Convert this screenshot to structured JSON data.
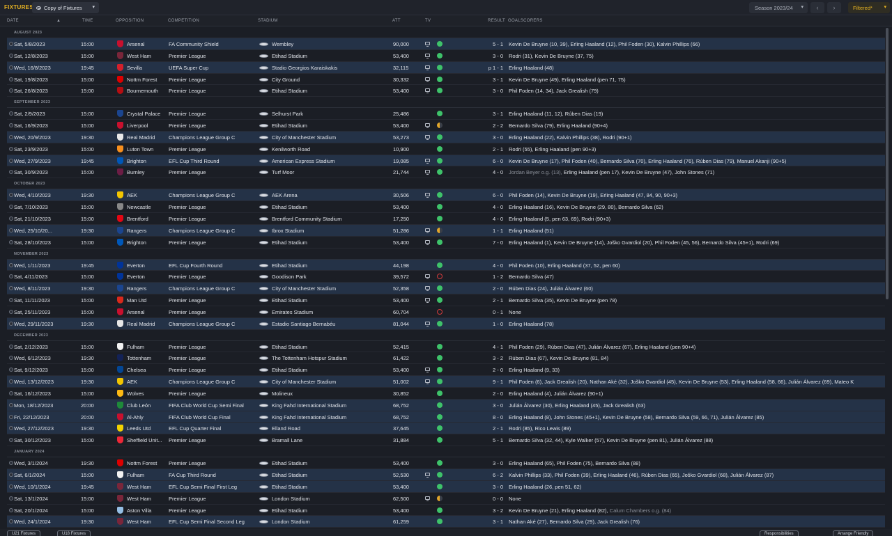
{
  "toolbar": {
    "title": "FIXTURES",
    "view": "Copy of Fixtures",
    "season": "Season 2023/24",
    "filter": "Filtered*"
  },
  "columns": {
    "date": "DATE",
    "time": "TIME",
    "opposition": "OPPOSITION",
    "competition": "COMPETITION",
    "stadium": "STADIUM",
    "att": "ATT",
    "tv": "TV",
    "result": "RESULT",
    "goalscorers": "GOALSCORERS"
  },
  "months": [
    {
      "label": "AUGUST 2023",
      "fixtures": [
        {
          "date": "Sat, 5/8/2023",
          "time": "15:00",
          "opp": "Arsenal",
          "comp": "FA Community Shield",
          "stadium": "Wembley",
          "att": "90,000",
          "tv": true,
          "outcome": "win",
          "result": "5 - 1",
          "scorers": "Kevin De Bruyne (10, 39), Erling Haaland (12), Phil Foden (30), Kalvin Phillips (66)",
          "badge": "#c8102e",
          "hl": true
        },
        {
          "date": "Sat, 12/8/2023",
          "time": "15:00",
          "opp": "West Ham",
          "comp": "Premier League",
          "stadium": "Etihad Stadium",
          "att": "53,400",
          "tv": true,
          "outcome": "win",
          "result": "3 - 0",
          "scorers": "Rodri (31), Kevin De Bruyne (37, 75)",
          "badge": "#7a263a",
          "hl": false
        },
        {
          "date": "Wed, 16/8/2023",
          "time": "19:45",
          "opp": "Sevilla",
          "comp": "UEFA Super Cup",
          "stadium": "Stadio Georgios Karaiskakis",
          "att": "32,115",
          "tv": true,
          "outcome": "win",
          "result": "p 1 - 1",
          "scorers": "Erling Haaland (48)",
          "badge": "#d4202b",
          "hl": true
        },
        {
          "date": "Sat, 19/8/2023",
          "time": "15:00",
          "opp": "Nottm Forest",
          "comp": "Premier League",
          "stadium": "City Ground",
          "att": "30,332",
          "tv": true,
          "outcome": "win",
          "result": "3 - 1",
          "scorers": "Kevin De Bruyne (49), Erling Haaland (pen 71, 75)",
          "badge": "#dd0000",
          "hl": false
        },
        {
          "date": "Sat, 26/8/2023",
          "time": "15:00",
          "opp": "Bournemouth",
          "comp": "Premier League",
          "stadium": "Etihad Stadium",
          "att": "53,400",
          "tv": true,
          "outcome": "win",
          "result": "3 - 0",
          "scorers": "Phil Foden (14, 34), Jack Grealish (79)",
          "badge": "#b50e12",
          "hl": false
        }
      ]
    },
    {
      "label": "SEPTEMBER 2023",
      "fixtures": [
        {
          "date": "Sat, 2/9/2023",
          "time": "15:00",
          "opp": "Crystal Palace",
          "comp": "Premier League",
          "stadium": "Selhurst Park",
          "att": "25,486",
          "tv": false,
          "outcome": "win",
          "result": "3 - 1",
          "scorers": "Erling Haaland (11, 12), Rúben Dias (19)",
          "badge": "#1b458f",
          "hl": false
        },
        {
          "date": "Sat, 16/9/2023",
          "time": "15:00",
          "opp": "Liverpool",
          "comp": "Premier League",
          "stadium": "Etihad Stadium",
          "att": "53,400",
          "tv": true,
          "outcome": "draw",
          "result": "2 - 2",
          "scorers": "Bernardo Silva (79), Erling Haaland (90+4)",
          "badge": "#c8102e",
          "hl": false
        },
        {
          "date": "Wed, 20/9/2023",
          "time": "19:30",
          "opp": "Real Madrid",
          "comp": "Champions League Group C",
          "stadium": "City of Manchester Stadium",
          "att": "53,273",
          "tv": true,
          "outcome": "win",
          "result": "3 - 0",
          "scorers": "Erling Haaland (22), Kalvin Phillips (38), Rodri (90+1)",
          "badge": "#e8e8e8",
          "hl": true
        },
        {
          "date": "Sat, 23/9/2023",
          "time": "15:00",
          "opp": "Luton Town",
          "comp": "Premier League",
          "stadium": "Kenilworth Road",
          "att": "10,900",
          "tv": false,
          "outcome": "win",
          "result": "2 - 1",
          "scorers": "Rodri (55), Erling Haaland (pen 90+3)",
          "badge": "#f78f1e",
          "hl": false
        },
        {
          "date": "Wed, 27/9/2023",
          "time": "19:45",
          "opp": "Brighton",
          "comp": "EFL Cup Third Round",
          "stadium": "American Express Stadium",
          "att": "19,085",
          "tv": true,
          "outcome": "win",
          "result": "6 - 0",
          "scorers": "Kevin De Bruyne (17), Phil Foden (40), Bernardo Silva (70), Erling Haaland (76), Rúben Dias (79), Manuel Akanji (90+5)",
          "badge": "#0057b8",
          "hl": true
        },
        {
          "date": "Sat, 30/9/2023",
          "time": "15:00",
          "opp": "Burnley",
          "comp": "Premier League",
          "stadium": "Turf Moor",
          "att": "21,744",
          "tv": true,
          "outcome": "win",
          "result": "4 - 0",
          "og": "Jordan Beyer o.g. (13),",
          "scorers": "Erling Haaland (pen 17), Kevin De Bruyne (47), John Stones (71)",
          "badge": "#6c1d45",
          "hl": false
        }
      ]
    },
    {
      "label": "OCTOBER 2023",
      "fixtures": [
        {
          "date": "Wed, 4/10/2023",
          "time": "19:30",
          "opp": "AEK",
          "comp": "Champions League Group C",
          "stadium": "AEK Arena",
          "att": "30,506",
          "tv": true,
          "outcome": "win",
          "result": "6 - 0",
          "scorers": "Phil Foden (14), Kevin De Bruyne (19), Erling Haaland (47, 84, 90, 90+3)",
          "badge": "#f2c500",
          "hl": true
        },
        {
          "date": "Sat, 7/10/2023",
          "time": "15:00",
          "opp": "Newcastle",
          "comp": "Premier League",
          "stadium": "Etihad Stadium",
          "att": "53,400",
          "tv": false,
          "outcome": "win",
          "result": "4 - 0",
          "scorers": "Erling Haaland (16), Kevin De Bruyne (29, 80), Bernardo Silva (62)",
          "badge": "#888888",
          "hl": false
        },
        {
          "date": "Sat, 21/10/2023",
          "time": "15:00",
          "opp": "Brentford",
          "comp": "Premier League",
          "stadium": "Brentford Community Stadium",
          "att": "17,250",
          "tv": false,
          "outcome": "win",
          "result": "4 - 0",
          "scorers": "Erling Haaland (5, pen 63, 69), Rodri (90+3)",
          "badge": "#e30613",
          "hl": false
        },
        {
          "date": "Wed, 25/10/20...",
          "time": "19:30",
          "opp": "Rangers",
          "comp": "Champions League Group C",
          "stadium": "Ibrox Stadium",
          "att": "51,286",
          "tv": true,
          "outcome": "draw",
          "result": "1 - 1",
          "scorers": "Erling Haaland (51)",
          "badge": "#1b458f",
          "hl": true
        },
        {
          "date": "Sat, 28/10/2023",
          "time": "15:00",
          "opp": "Brighton",
          "comp": "Premier League",
          "stadium": "Etihad Stadium",
          "att": "53,400",
          "tv": true,
          "outcome": "win",
          "result": "7 - 0",
          "scorers": "Erling Haaland (1), Kevin De Bruyne (14), Joško Gvardiol (20), Phil Foden (45, 56), Bernardo Silva (45+1), Rodri (69)",
          "badge": "#0057b8",
          "hl": false
        }
      ]
    },
    {
      "label": "NOVEMBER 2023",
      "fixtures": [
        {
          "date": "Wed, 1/11/2023",
          "time": "19:45",
          "opp": "Everton",
          "comp": "EFL Cup Fourth Round",
          "stadium": "Etihad Stadium",
          "att": "44,198",
          "tv": false,
          "outcome": "win",
          "result": "4 - 0",
          "scorers": "Phil Foden (10), Erling Haaland (37, 52, pen 60)",
          "badge": "#003399",
          "hl": true
        },
        {
          "date": "Sat, 4/11/2023",
          "time": "15:00",
          "opp": "Everton",
          "comp": "Premier League",
          "stadium": "Goodison Park",
          "att": "39,572",
          "tv": true,
          "outcome": "loss",
          "result": "1 - 2",
          "scorers": "Bernardo Silva (47)",
          "badge": "#003399",
          "hl": false
        },
        {
          "date": "Wed, 8/11/2023",
          "time": "19:30",
          "opp": "Rangers",
          "comp": "Champions League Group C",
          "stadium": "City of Manchester Stadium",
          "att": "52,358",
          "tv": true,
          "outcome": "win",
          "result": "2 - 0",
          "scorers": "Rúben Dias (24), Julián Álvarez (60)",
          "badge": "#1b458f",
          "hl": true
        },
        {
          "date": "Sat, 11/11/2023",
          "time": "15:00",
          "opp": "Man Utd",
          "comp": "Premier League",
          "stadium": "Etihad Stadium",
          "att": "53,400",
          "tv": true,
          "outcome": "win",
          "result": "2 - 1",
          "scorers": "Bernardo Silva (35), Kevin De Bruyne (pen 78)",
          "badge": "#da291c",
          "hl": false
        },
        {
          "date": "Sat, 25/11/2023",
          "time": "15:00",
          "opp": "Arsenal",
          "comp": "Premier League",
          "stadium": "Emirates Stadium",
          "att": "60,704",
          "tv": false,
          "outcome": "loss",
          "result": "0 - 1",
          "scorers": "None",
          "badge": "#c8102e",
          "hl": false
        },
        {
          "date": "Wed, 29/11/2023",
          "time": "19:30",
          "opp": "Real Madrid",
          "comp": "Champions League Group C",
          "stadium": "Estadio Santiago Bernabéu",
          "att": "81,044",
          "tv": true,
          "outcome": "win",
          "result": "1 - 0",
          "scorers": "Erling Haaland (78)",
          "badge": "#e8e8e8",
          "hl": true
        }
      ]
    },
    {
      "label": "DECEMBER 2023",
      "fixtures": [
        {
          "date": "Sat, 2/12/2023",
          "time": "15:00",
          "opp": "Fulham",
          "comp": "Premier League",
          "stadium": "Etihad Stadium",
          "att": "52,415",
          "tv": false,
          "outcome": "win",
          "result": "4 - 1",
          "scorers": "Phil Foden (29), Rúben Dias (47), Julián Álvarez (67), Erling Haaland (pen 90+4)",
          "badge": "#f2f2f2",
          "hl": false
        },
        {
          "date": "Wed, 6/12/2023",
          "time": "19:30",
          "opp": "Tottenham",
          "comp": "Premier League",
          "stadium": "The Tottenham Hotspur Stadium",
          "att": "61,422",
          "tv": false,
          "outcome": "win",
          "result": "3 - 2",
          "scorers": "Rúben Dias (67), Kevin De Bruyne (81, 84)",
          "badge": "#132257",
          "hl": false
        },
        {
          "date": "Sat, 9/12/2023",
          "time": "15:00",
          "opp": "Chelsea",
          "comp": "Premier League",
          "stadium": "Etihad Stadium",
          "att": "53,400",
          "tv": true,
          "outcome": "win",
          "result": "2 - 0",
          "scorers": "Erling Haaland (9, 33)",
          "badge": "#034694",
          "hl": false
        },
        {
          "date": "Wed, 13/12/2023",
          "time": "19:30",
          "opp": "AEK",
          "comp": "Champions League Group C",
          "stadium": "City of Manchester Stadium",
          "att": "51,002",
          "tv": true,
          "outcome": "win",
          "result": "9 - 1",
          "scorers": "Phil Foden (6), Jack Grealish (20), Nathan Aké (32), Joško Gvardiol (45), Kevin De Bruyne (53), Erling Haaland (58, 66), Julián Álvarez (69), Mateo K",
          "badge": "#f2c500",
          "hl": true
        },
        {
          "date": "Sat, 16/12/2023",
          "time": "15:00",
          "opp": "Wolves",
          "comp": "Premier League",
          "stadium": "Molineux",
          "att": "30,852",
          "tv": false,
          "outcome": "win",
          "result": "2 - 0",
          "scorers": "Erling Haaland (4), Julián Álvarez (90+1)",
          "badge": "#fdb913",
          "hl": false
        },
        {
          "date": "Mon, 18/12/2023",
          "time": "20:00",
          "opp": "Club León",
          "comp": "FIFA Club World Cup Semi Final",
          "stadium": "King Fahd International Stadium",
          "att": "68,752",
          "tv": false,
          "outcome": "win",
          "result": "3 - 0",
          "scorers": "Julián Álvarez (30), Erling Haaland (45), Jack Grealish (63)",
          "badge": "#1e8a3a",
          "hl": true
        },
        {
          "date": "Fri, 22/12/2023",
          "time": "20:00",
          "opp": "Al-Ahly",
          "comp": "FIFA Club World Cup Final",
          "stadium": "King Fahd International Stadium",
          "att": "68,752",
          "tv": false,
          "outcome": "win",
          "result": "8 - 0",
          "scorers": "Erling Haaland (8), John Stones (45+1), Kevin De Bruyne (58), Bernardo Silva (59, 66, 71), Julián Álvarez (85)",
          "badge": "#c8102e",
          "hl": true
        },
        {
          "date": "Wed, 27/12/2023",
          "time": "19:30",
          "opp": "Leeds Utd",
          "comp": "EFL Cup Quarter Final",
          "stadium": "Elland Road",
          "att": "37,645",
          "tv": false,
          "outcome": "win",
          "result": "2 - 1",
          "scorers": "Rodri (85), Rico Lewis (89)",
          "badge": "#f2d200",
          "hl": true
        },
        {
          "date": "Sat, 30/12/2023",
          "time": "15:00",
          "opp": "Sheffield Unit...",
          "comp": "Premier League",
          "stadium": "Bramall Lane",
          "att": "31,884",
          "tv": false,
          "outcome": "win",
          "result": "5 - 1",
          "scorers": "Bernardo Silva (32, 44), Kyle Walker (57), Kevin De Bruyne (pen 81), Julián Álvarez (88)",
          "badge": "#ee2737",
          "hl": false
        }
      ]
    },
    {
      "label": "JANUARY 2024",
      "fixtures": [
        {
          "date": "Wed, 3/1/2024",
          "time": "19:30",
          "opp": "Nottm Forest",
          "comp": "Premier League",
          "stadium": "Etihad Stadium",
          "att": "53,400",
          "tv": false,
          "outcome": "win",
          "result": "3 - 0",
          "scorers": "Erling Haaland (65), Phil Foden (75), Bernardo Silva (88)",
          "badge": "#dd0000",
          "hl": false
        },
        {
          "date": "Sat, 6/1/2024",
          "time": "15:00",
          "opp": "Fulham",
          "comp": "FA Cup Third Round",
          "stadium": "Etihad Stadium",
          "att": "52,530",
          "tv": true,
          "outcome": "win",
          "result": "6 - 2",
          "scorers": "Kalvin Phillips (33), Phil Foden (39), Erling Haaland (46), Rúben Dias (65), Joško Gvardiol (68), Julián Álvarez (87)",
          "badge": "#f2f2f2",
          "hl": true
        },
        {
          "date": "Wed, 10/1/2024",
          "time": "19:45",
          "opp": "West Ham",
          "comp": "EFL Cup Semi Final First Leg",
          "stadium": "Etihad Stadium",
          "att": "53,400",
          "tv": false,
          "outcome": "win",
          "result": "3 - 0",
          "scorers": "Erling Haaland (26, pen 51, 62)",
          "badge": "#7a263a",
          "hl": true
        },
        {
          "date": "Sat, 13/1/2024",
          "time": "15:00",
          "opp": "West Ham",
          "comp": "Premier League",
          "stadium": "London Stadium",
          "att": "62,500",
          "tv": true,
          "outcome": "draw",
          "result": "0 - 0",
          "scorers": "None",
          "badge": "#7a263a",
          "hl": false
        },
        {
          "date": "Sat, 20/1/2024",
          "time": "15:00",
          "opp": "Aston Villa",
          "comp": "Premier League",
          "stadium": "Etihad Stadium",
          "att": "53,400",
          "tv": false,
          "outcome": "win",
          "result": "3 - 2",
          "scorers": "Kevin De Bruyne (21), Erling Haaland (82),",
          "og2": "Calum Chambers o.g. (84)",
          "badge": "#95bfe5",
          "hl": false
        },
        {
          "date": "Wed, 24/1/2024",
          "time": "19:30",
          "opp": "West Ham",
          "comp": "EFL Cup Semi Final Second Leg",
          "stadium": "London Stadium",
          "att": "61,259",
          "tv": false,
          "outcome": "win",
          "result": "3 - 1",
          "scorers": "Nathan Aké (27), Bernardo Silva (29), Jack Grealish (76)",
          "badge": "#7a263a",
          "hl": true
        }
      ]
    }
  ],
  "footer": {
    "btn1": "U21 Fixtures",
    "btn2": "U18 Fixtures",
    "btn3": "Responsibilities",
    "btn4": "Arrange Friendly"
  }
}
